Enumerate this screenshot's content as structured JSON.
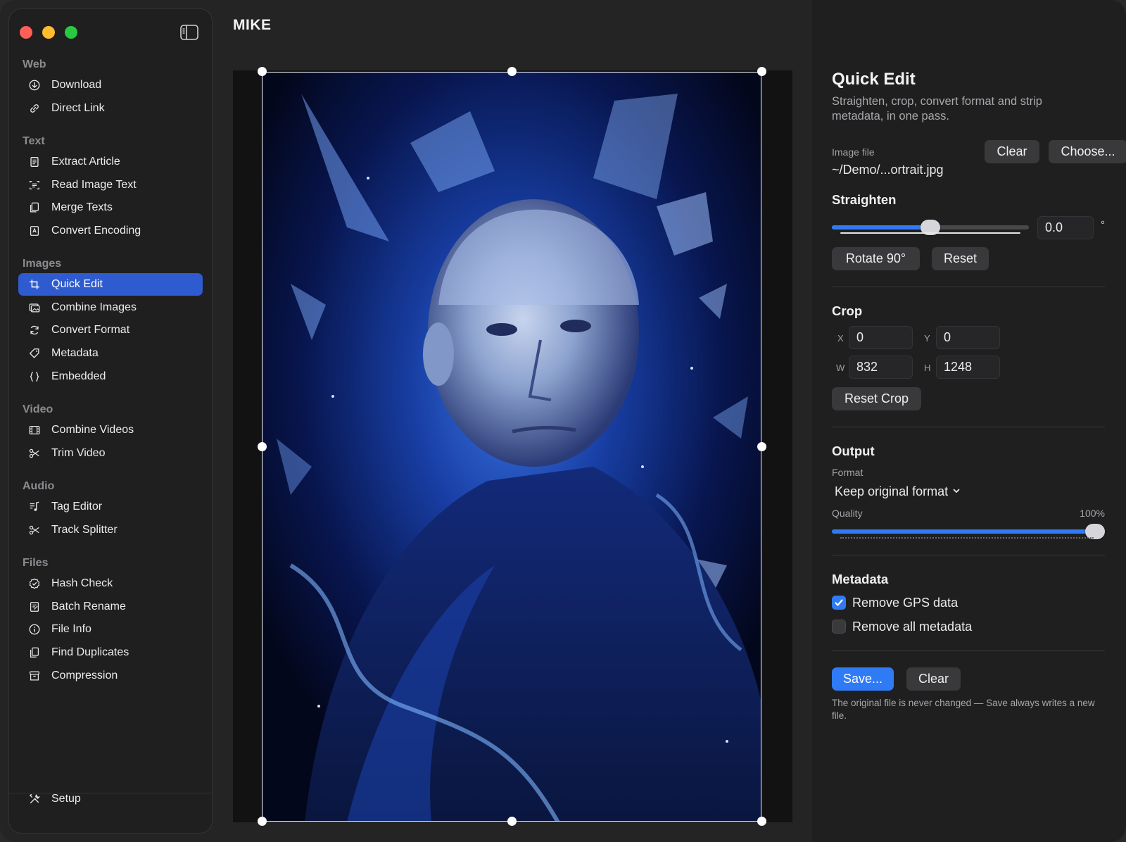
{
  "window": {
    "title": "MIKE"
  },
  "sidebar": {
    "sections": [
      {
        "title": "Web",
        "items": [
          {
            "label": "Download",
            "icon": "download-icon"
          },
          {
            "label": "Direct Link",
            "icon": "link-icon"
          }
        ]
      },
      {
        "title": "Text",
        "items": [
          {
            "label": "Extract Article",
            "icon": "document-icon"
          },
          {
            "label": "Read Image Text",
            "icon": "text-scan-icon"
          },
          {
            "label": "Merge Texts",
            "icon": "merge-docs-icon"
          },
          {
            "label": "Convert Encoding",
            "icon": "encoding-icon"
          }
        ]
      },
      {
        "title": "Images",
        "items": [
          {
            "label": "Quick Edit",
            "icon": "crop-icon",
            "active": true
          },
          {
            "label": "Combine Images",
            "icon": "images-icon"
          },
          {
            "label": "Convert Format",
            "icon": "convert-icon"
          },
          {
            "label": "Metadata",
            "icon": "tag-icon"
          },
          {
            "label": "Embedded",
            "icon": "braces-icon"
          }
        ]
      },
      {
        "title": "Video",
        "items": [
          {
            "label": "Combine Videos",
            "icon": "film-icon"
          },
          {
            "label": "Trim Video",
            "icon": "scissors-icon"
          }
        ]
      },
      {
        "title": "Audio",
        "items": [
          {
            "label": "Tag Editor",
            "icon": "music-list-icon"
          },
          {
            "label": "Track Splitter",
            "icon": "scissors-icon"
          }
        ]
      },
      {
        "title": "Files",
        "items": [
          {
            "label": "Hash Check",
            "icon": "checkmark-seal-icon"
          },
          {
            "label": "Batch Rename",
            "icon": "rename-icon"
          },
          {
            "label": "File Info",
            "icon": "info-icon"
          },
          {
            "label": "Find Duplicates",
            "icon": "duplicate-icon"
          },
          {
            "label": "Compression",
            "icon": "archive-icon"
          }
        ]
      }
    ],
    "footer": {
      "label": "Setup",
      "icon": "tools-icon"
    }
  },
  "panel": {
    "title": "Quick Edit",
    "description": "Straighten, crop, convert format and strip metadata, in one pass.",
    "image_file": {
      "label": "Image file",
      "value": "~/Demo/...ortrait.jpg",
      "clear_label": "Clear",
      "choose_label": "Choose..."
    },
    "straighten": {
      "title": "Straighten",
      "value": "0.0",
      "unit": "°",
      "position": 0.5,
      "rotate_label": "Rotate 90°",
      "reset_label": "Reset"
    },
    "crop": {
      "title": "Crop",
      "x_label": "X",
      "x": "0",
      "y_label": "Y",
      "y": "0",
      "w_label": "W",
      "w": "832",
      "h_label": "H",
      "h": "1248",
      "reset_label": "Reset Crop"
    },
    "output": {
      "title": "Output",
      "format_label": "Format",
      "format_value": "Keep original format",
      "quality_label": "Quality",
      "quality_value": "100%",
      "quality_fraction": 1.0
    },
    "metadata": {
      "title": "Metadata",
      "remove_gps_label": "Remove GPS data",
      "remove_gps_checked": true,
      "remove_all_label": "Remove all metadata",
      "remove_all_checked": false
    },
    "actions": {
      "save_label": "Save...",
      "clear_label": "Clear",
      "footnote": "The original file is never changed — Save always writes a new file."
    }
  },
  "colors": {
    "accent": "#2f7bf6",
    "sidebar_active": "#2f5bd0"
  }
}
